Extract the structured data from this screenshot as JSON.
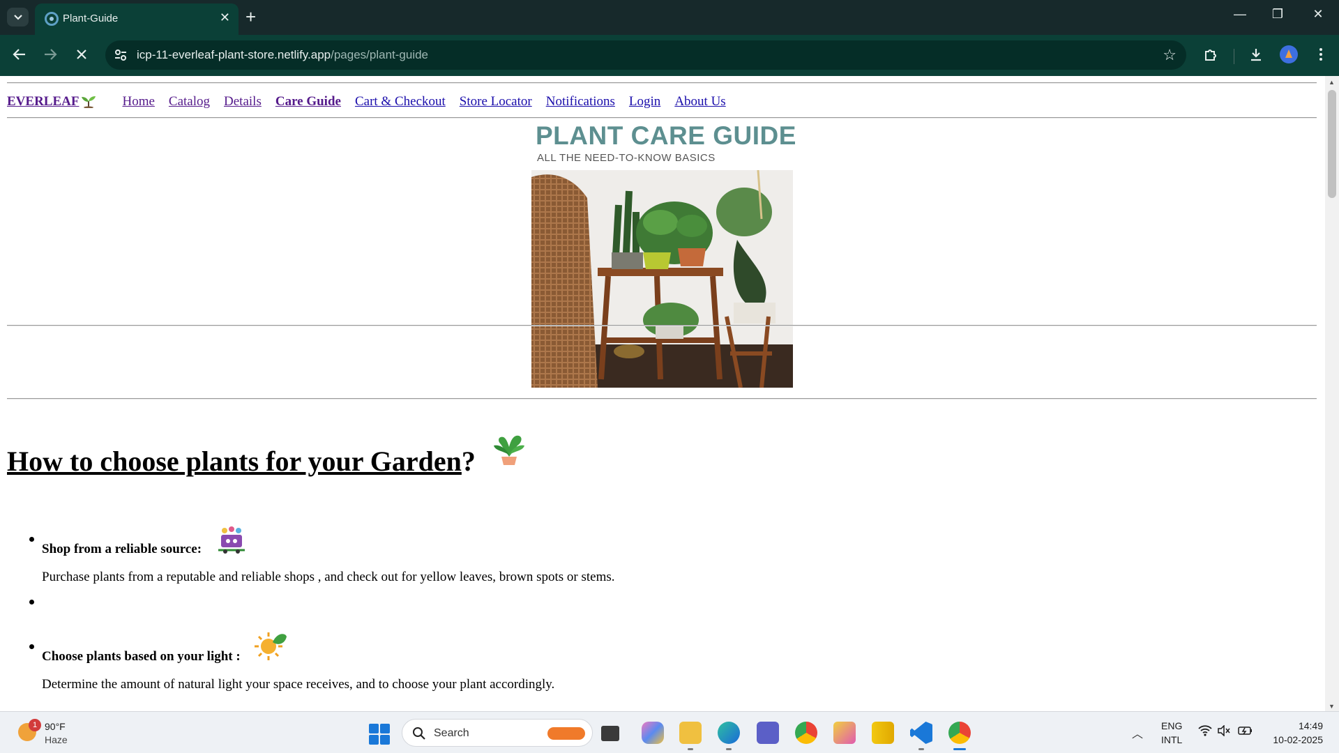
{
  "browser": {
    "tab_title": "Plant-Guide",
    "url_host": "icp-11-everleaf-plant-store.netlify.app",
    "url_path": "/pages/plant-guide"
  },
  "site": {
    "brand": "EVERLEAF",
    "nav": [
      "Home",
      "Catalog",
      "Details",
      "Care Guide",
      "Cart & Checkout",
      "Store Locator",
      "Notifications",
      "Login",
      "About Us"
    ],
    "current_nav": "Care Guide"
  },
  "hero": {
    "title": "PLANT CARE GUIDE",
    "subtitle": "ALL THE NEED-TO-KNOW BASICS"
  },
  "section": {
    "title_link": "How to choose plants for your Garden",
    "title_suffix": "?"
  },
  "tips": [
    {
      "heading": "Shop from a reliable source:",
      "body": "Purchase plants from a reputable and reliable shops , and check out for yellow leaves, brown spots or stems.",
      "icon": "flower-cart-icon"
    },
    {
      "heading": "Choose plants based on your light :",
      "body": "Determine the amount of natural light your space receives, and to choose your plant accordingly.",
      "icon": "sun-leaf-icon"
    }
  ],
  "taskbar": {
    "weather_temp": "90°F",
    "weather_cond": "Haze",
    "weather_badge": "1",
    "search_placeholder": "Search",
    "lang_top": "ENG",
    "lang_bottom": "INTL",
    "time": "14:49",
    "date": "10-02-2025"
  },
  "colors": {
    "chrome_dark": "#17292b",
    "chrome_green": "#0b4037",
    "link": "#1a0dab",
    "visited": "#551a8b"
  }
}
